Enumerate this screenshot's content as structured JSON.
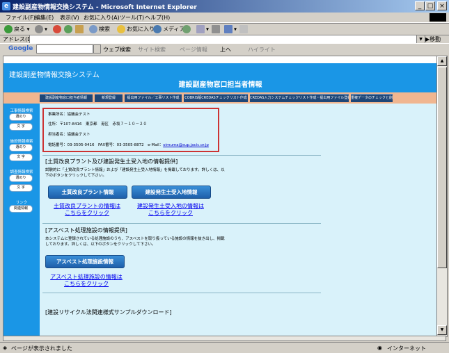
{
  "window": {
    "title": "建設副産物情報交換システム - Microsoft Internet Explorer",
    "min": "_",
    "max": "□",
    "close": "×"
  },
  "menu": [
    "ファイル(F)",
    "編集(E)",
    "表示(V)",
    "お気に入り(A)",
    "ツール(T)",
    "ヘルプ(H)"
  ],
  "toolbar": {
    "back": "戻る",
    "search": "検索",
    "favorites": "お気に入り",
    "media": "メディア"
  },
  "address": {
    "label": "アドレス(D)",
    "go": "移動"
  },
  "google": {
    "logo": "Google",
    "web_search": "ウェブ検索",
    "site_search": "サイト検索",
    "page_info": "ページ情報",
    "up": "上へ",
    "highlight": "ハイライト"
  },
  "banner": {
    "site_title": "建設副産物情報交換システム",
    "page_title": "建設副産物窓口担当者情報"
  },
  "tabs": [
    "建設副産物窓口担当者情報",
    "新規登録",
    "提出用ファイル／工事リスト作成",
    "COBRIS版CREDASチェックリスト作成",
    "CREDAS入力システムチェックリスト作成・提出用ファイル登録",
    "重複データのチェックと削除"
  ],
  "sidebar": {
    "sections": [
      {
        "heading": "工事情報検索",
        "buttons": [
          "選のり",
          "文 字"
        ]
      },
      {
        "heading": "施設情報検索",
        "buttons": [
          "選のり",
          "文 字"
        ]
      },
      {
        "heading": "調査情報検索",
        "buttons": [
          "選のり",
          "文 字"
        ]
      },
      {
        "heading": "リンク",
        "buttons": [
          "関連情報"
        ]
      }
    ]
  },
  "info": {
    "office": "事業所名：協議会テスト",
    "address": "住所：〒107-8416　東京都　港区　赤坂７－１０－２０",
    "contact": "担当者名：協議会テスト",
    "phone": "電話番号：03-3505-0416",
    "fax": "FAX番号：03-3505-8872",
    "email_label": "e-Mail：",
    "email": "oimuma@sup.jacic.or.jp"
  },
  "section1": {
    "heading": "[土質改良プラント及び建設発生土受入地の情報提供]",
    "text": "試験的に「土質改良プラント情報」および「建設発生土受入地情報」を掲載しております。詳しくは、以下のボタンをクリックして下さい。",
    "button1": "土質改良プラント情報",
    "button2": "建設発生土受入地情報",
    "link1_line1": "土質改良プラントの情報は",
    "link1_line2": "こちらをクリック",
    "link2_line1": "建設発生土受入地の情報は",
    "link2_line2": "こちらをクリック"
  },
  "section2": {
    "heading": "[アスベスト処理施設の情報提供]",
    "text": "本システムに登録されている処理施設のうち、アスベストを取り扱っている施設の情報を抜き出し、掲載しております。詳しくは、以下のボタンをクリックして下さい。",
    "button": "アスベスト処理施設情報",
    "link_line1": "アスベスト処理施設の情報は",
    "link_line2": "こちらをクリック"
  },
  "section3": {
    "heading": "[建設リサイクル法関連様式サンプルダウンロード]"
  },
  "status": {
    "text": "ページが表示されました",
    "zone": "インターネット"
  }
}
